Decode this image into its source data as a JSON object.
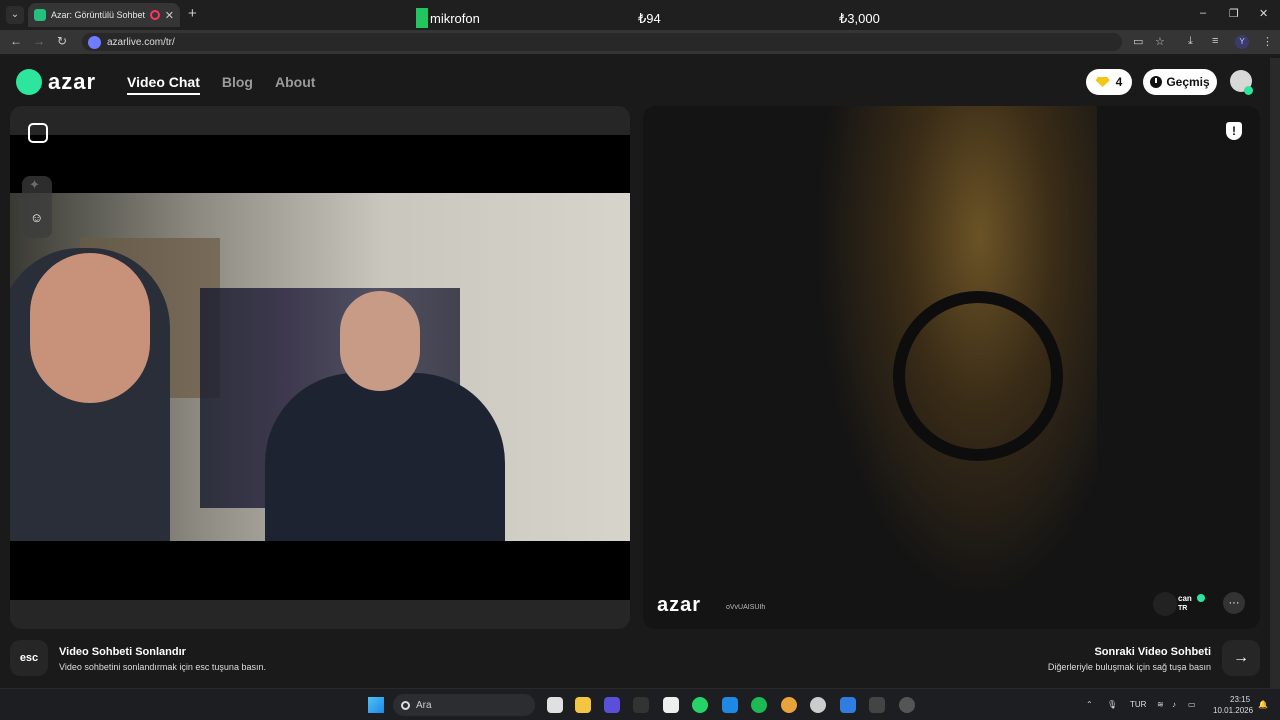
{
  "browser": {
    "tab_title": "Azar: Görüntülü Sohbet & V",
    "tab_close": "✕",
    "new_tab": "+",
    "url": "azarlive.com/tr/",
    "window_controls": [
      "–",
      "❐",
      "✕"
    ],
    "profile_initial": "Y"
  },
  "overlay": {
    "mic_label": "mikrofon",
    "value_1": "₺94",
    "value_2": "₺3,000"
  },
  "site": {
    "logo_text": "azar",
    "nav": [
      {
        "label": "Video Chat",
        "active": true
      },
      {
        "label": "Blog",
        "active": false
      },
      {
        "label": "About",
        "active": false
      }
    ],
    "gem_count": "4",
    "history_label": "Geçmiş"
  },
  "peer": {
    "watermark": "azar",
    "watermark_id": "oVvUAISUIh",
    "name": "can",
    "country": "TR"
  },
  "footer": {
    "esc_label": "esc",
    "end_title": "Video Sohbeti Sonlandır",
    "end_desc": "Video sohbetini sonlandırmak için esc tuşuna basın.",
    "next_title": "Sonraki Video Sohbeti",
    "next_desc": "Diğerleriyle buluşmak için sağ tuşa basın",
    "next_arrow": "→"
  },
  "taskbar": {
    "search_placeholder": "Ara",
    "lang": "TUR",
    "time": "23:15",
    "date": "10.01.2026"
  },
  "colors": {
    "accent": "#2ee59d",
    "mic": "#22c55e",
    "gem": "#f5c518"
  }
}
